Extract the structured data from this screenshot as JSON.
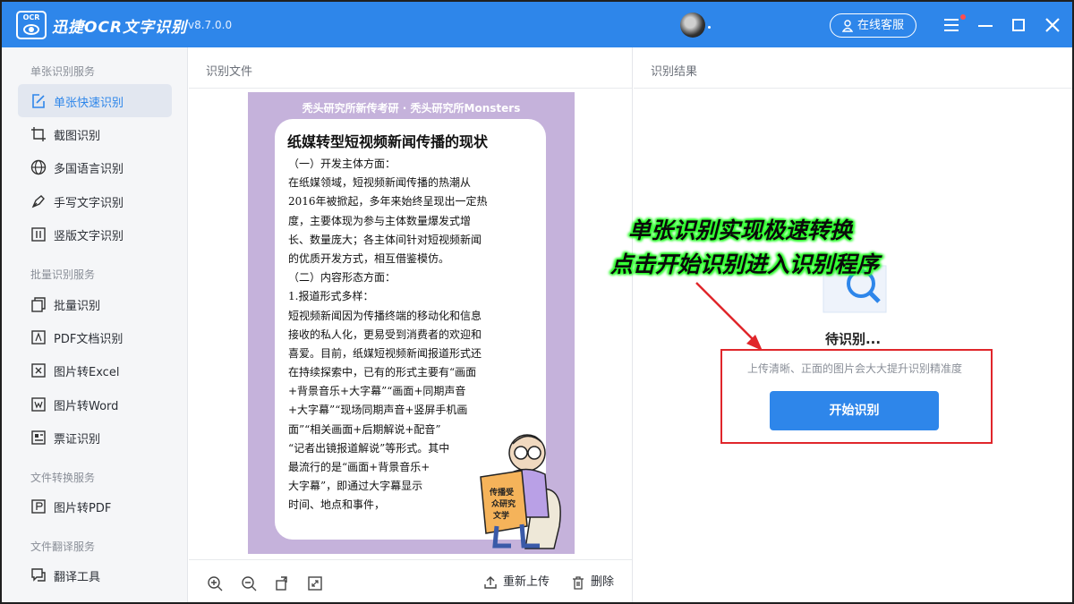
{
  "app": {
    "logo_text": "OCR",
    "title": "迅捷OCR文字识别",
    "version": "v8.7.0.0",
    "online_service": "在线客服"
  },
  "sidebar": {
    "sections": [
      {
        "label": "单张识别服务",
        "items": [
          {
            "label": "单张快速识别",
            "icon": "quick-scan-icon",
            "active": true
          },
          {
            "label": "截图识别",
            "icon": "crop-icon"
          },
          {
            "label": "多国语言识别",
            "icon": "globe-icon"
          },
          {
            "label": "手写文字识别",
            "icon": "pen-icon"
          },
          {
            "label": "竖版文字识别",
            "icon": "vertical-text-icon"
          }
        ]
      },
      {
        "label": "批量识别服务",
        "items": [
          {
            "label": "批量识别",
            "icon": "batch-icon"
          },
          {
            "label": "PDF文档识别",
            "icon": "pdf-icon"
          },
          {
            "label": "图片转Excel",
            "icon": "excel-icon"
          },
          {
            "label": "图片转Word",
            "icon": "word-icon"
          },
          {
            "label": "票证识别",
            "icon": "ticket-icon"
          }
        ]
      },
      {
        "label": "文件转换服务",
        "items": [
          {
            "label": "图片转PDF",
            "icon": "image-to-pdf-icon"
          }
        ]
      },
      {
        "label": "文件翻译服务",
        "items": [
          {
            "label": "翻译工具",
            "icon": "translate-icon"
          }
        ]
      }
    ]
  },
  "file_panel": {
    "title": "识别文件",
    "preview": {
      "header": "秃头研究所新传考研 · 秃头研究所Monsters",
      "doc_title": "纸媒转型短视频新闻传播的现状",
      "lines": [
        "（一）开发主体方面：",
        "在纸媒领域，短视频新闻传播的热潮从",
        "2016年被掀起，多年来始终呈现出一定热",
        "度，主要体现为参与主体数量爆发式增",
        "长、数量庞大；各主体间针对短视频新闻",
        "的优质开发方式，相互借鉴模仿。",
        "（二）内容形态方面：",
        "1.报道形式多样：",
        "短视频新闻因为传播终端的移动化和信息",
        "接收的私人化，更易受到消费者的欢迎和",
        "喜爱。目前，纸媒短视频新闻报道形式还",
        "在持续探索中，已有的形式主要有“画面",
        "+背景音乐+大字幕”“画面+同期声音",
        "+大字幕”“现场同期声音+竖屏手机画",
        "面”“相关画面+后期解说+配音”",
        "“记者出镜报道解说”等形式。其中",
        "最流行的是“画面+背景音乐+",
        "大字幕”，即通过大字幕显示",
        "时间、地点和事件，"
      ],
      "cartoon_text": "传播受众研究文学"
    },
    "toolbar": {
      "reupload": "重新上传",
      "delete": "删除"
    }
  },
  "result_panel": {
    "title": "识别结果",
    "status": "待识别...",
    "hint": "上传清晰、正面的图片会大大提升识别精准度",
    "start_button": "开始识别"
  },
  "overlay": {
    "line1": "单张识别实现极速转换",
    "line2": "点击开始识别进入识别程序"
  },
  "colors": {
    "brand": "#2e86ea",
    "highlight_box": "#e0262b",
    "overlay_glow": "#2cff2c"
  }
}
